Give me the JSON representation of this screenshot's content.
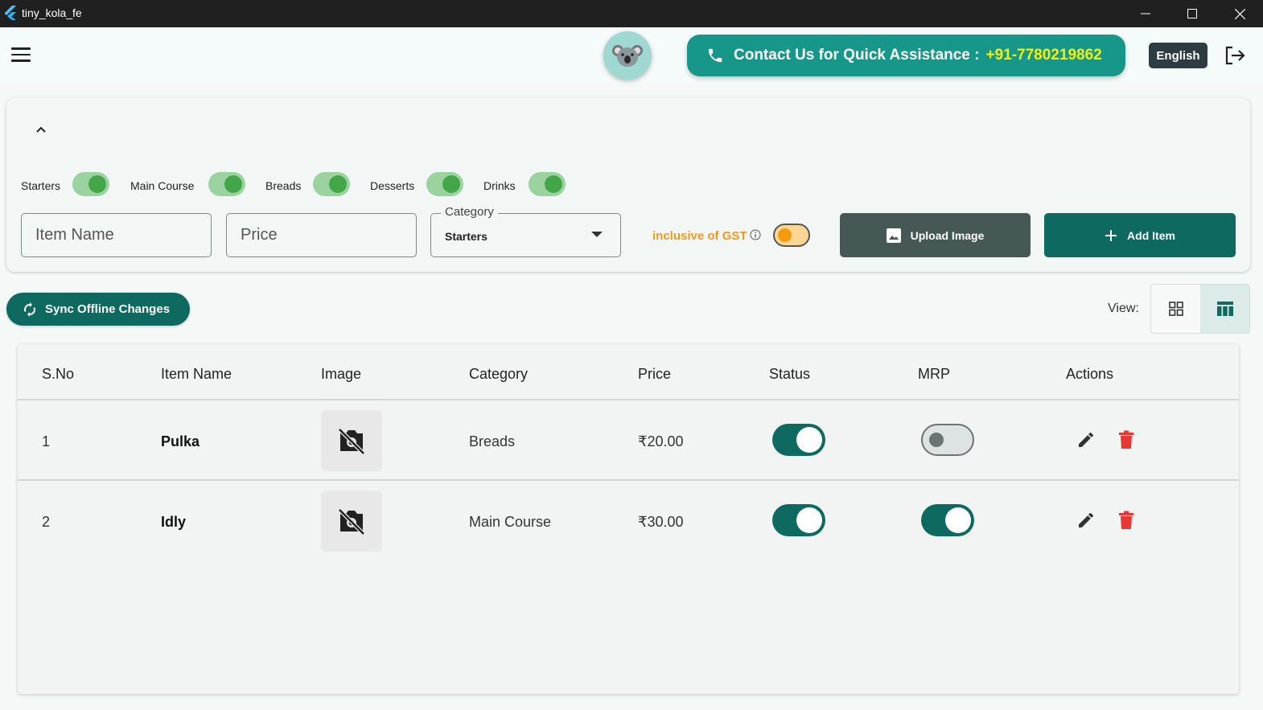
{
  "window": {
    "title": "tiny_kola_fe"
  },
  "header": {
    "contact_label": "Contact Us for Quick Assistance :",
    "contact_phone": "+91-7780219862",
    "language": "English"
  },
  "form": {
    "category_toggles": [
      {
        "label": "Starters",
        "on": true
      },
      {
        "label": "Main Course",
        "on": true
      },
      {
        "label": "Breads",
        "on": true
      },
      {
        "label": "Desserts",
        "on": true
      },
      {
        "label": "Drinks",
        "on": true
      }
    ],
    "item_name_placeholder": "Item Name",
    "price_placeholder": "Price",
    "category_legend": "Category",
    "category_value": "Starters",
    "gst_label": "inclusive of GST",
    "upload_label": "Upload Image",
    "add_label": "Add Item"
  },
  "toolbar": {
    "sync_label": "Sync Offline Changes",
    "view_label": "View:",
    "active_view": "table"
  },
  "table": {
    "headers": [
      "S.No",
      "Item Name",
      "Image",
      "Category",
      "Price",
      "Status",
      "MRP",
      "Actions"
    ],
    "rows": [
      {
        "sno": "1",
        "name": "Pulka",
        "category": "Breads",
        "price": "₹20.00",
        "status": true,
        "mrp": false
      },
      {
        "sno": "2",
        "name": "Idly",
        "category": "Main Course",
        "price": "₹30.00",
        "status": true,
        "mrp": true
      }
    ]
  },
  "colors": {
    "primary": "#0e6a61",
    "contact_bg": "#17968a",
    "phone_highlight": "#f4f00a",
    "gst_orange": "#f39a1e",
    "delete_red": "#e53935"
  }
}
